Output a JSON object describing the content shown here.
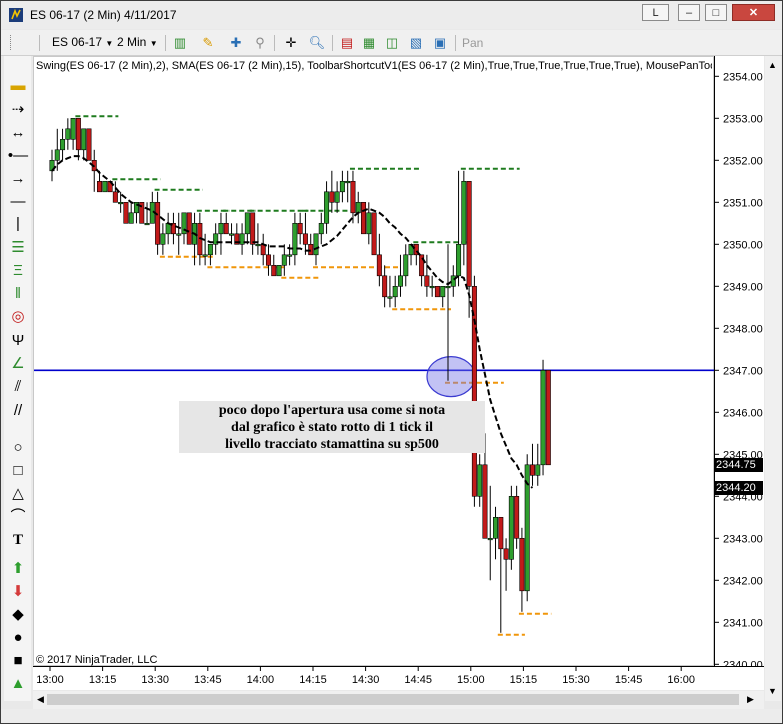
{
  "window": {
    "title": "ES 06-17 (2 Min)  4/11/2017",
    "buttons": {
      "layout": "L",
      "minimize": "–",
      "maximize": "□",
      "close": "✕"
    }
  },
  "toolbar": {
    "instrument": "ES 06-17",
    "interval": "2 Min",
    "pan_label": "Pan",
    "icons": [
      "bars-icon",
      "pencil-icon",
      "crosshair-add-icon",
      "zoom-icon",
      "crosshair-icon",
      "magnify-icon",
      "strategy-icon",
      "indicator-icon",
      "properties-icon",
      "data-box-icon"
    ]
  },
  "chart": {
    "indicator_label": "Swing(ES 06-17 (2 Min),2), SMA(ES 06-17 (2 Min),15), ToolbarShortcutV1(ES 06-17 (2 Min),True,True,True,True,True,True), MousePanTool",
    "copyright": "© 2017 NinjaTrader, LLC",
    "annotation_lines": [
      "poco dopo l'apertura usa come si nota",
      "dal grafico è stato rotto di 1 tick il",
      "livello tracciato stamattina su sp500"
    ],
    "last_price": "2344.75",
    "sma_value": "2344.20",
    "horizontal_line_price": 2347.0,
    "colors": {
      "up": "#2e9e2e",
      "down": "#c21a1a",
      "swing_high": "#1e7b1e",
      "swing_low": "#f0960a",
      "level": "#0000cc",
      "sma": "#000000"
    }
  },
  "chart_data": {
    "type": "candlestick",
    "yaxis_ticks": [
      "2354.00",
      "2353.00",
      "2352.00",
      "2351.00",
      "2350.00",
      "2349.00",
      "2348.00",
      "2347.00",
      "2346.00",
      "2345.00",
      "2344.00",
      "2343.00",
      "2342.00",
      "2341.00",
      "2340.00"
    ],
    "xaxis_ticks": [
      "13:00",
      "13:15",
      "13:30",
      "13:45",
      "14:00",
      "14:15",
      "14:30",
      "14:45",
      "15:00",
      "15:15",
      "15:30",
      "15:45",
      "16:00"
    ],
    "ylim": [
      2340,
      2354.5
    ],
    "bars": [
      {
        "t": "13:00",
        "o": 2351.75,
        "h": 2352.25,
        "l": 2351.5,
        "c": 2352.0
      },
      {
        "t": "13:02",
        "o": 2352.0,
        "h": 2352.75,
        "l": 2351.75,
        "c": 2352.25
      },
      {
        "t": "13:04",
        "o": 2352.25,
        "h": 2352.75,
        "l": 2352.0,
        "c": 2352.5
      },
      {
        "t": "13:06",
        "o": 2352.5,
        "h": 2353.0,
        "l": 2352.25,
        "c": 2352.75
      },
      {
        "t": "13:08",
        "o": 2352.5,
        "h": 2353.0,
        "l": 2352.25,
        "c": 2353.0
      },
      {
        "t": "13:10",
        "o": 2353.0,
        "h": 2353.0,
        "l": 2352.0,
        "c": 2352.25
      },
      {
        "t": "13:12",
        "o": 2352.25,
        "h": 2352.75,
        "l": 2352.0,
        "c": 2352.75
      },
      {
        "t": "13:14",
        "o": 2352.75,
        "h": 2352.75,
        "l": 2352.0,
        "c": 2352.0
      },
      {
        "t": "13:16",
        "o": 2352.0,
        "h": 2352.25,
        "l": 2351.25,
        "c": 2351.75
      },
      {
        "t": "13:18",
        "o": 2351.5,
        "h": 2351.75,
        "l": 2351.25,
        "c": 2351.25
      },
      {
        "t": "13:20",
        "o": 2351.25,
        "h": 2351.5,
        "l": 2351.25,
        "c": 2351.5
      },
      {
        "t": "13:22",
        "o": 2351.5,
        "h": 2351.5,
        "l": 2351.25,
        "c": 2351.25
      },
      {
        "t": "13:24",
        "o": 2351.25,
        "h": 2351.5,
        "l": 2351.0,
        "c": 2351.0
      },
      {
        "t": "13:26",
        "o": 2351.0,
        "h": 2351.25,
        "l": 2350.75,
        "c": 2351.0
      },
      {
        "t": "13:28",
        "o": 2351.0,
        "h": 2351.0,
        "l": 2350.5,
        "c": 2350.5
      },
      {
        "t": "13:30",
        "o": 2350.5,
        "h": 2351.0,
        "l": 2350.5,
        "c": 2350.75
      },
      {
        "t": "13:32",
        "o": 2350.75,
        "h": 2351.0,
        "l": 2350.5,
        "c": 2351.0
      },
      {
        "t": "13:34",
        "o": 2351.0,
        "h": 2351.0,
        "l": 2350.5,
        "c": 2350.5
      },
      {
        "t": "13:36",
        "o": 2350.5,
        "h": 2351.0,
        "l": 2350.5,
        "c": 2350.5
      },
      {
        "t": "13:38",
        "o": 2350.5,
        "h": 2351.25,
        "l": 2350.5,
        "c": 2351.0
      },
      {
        "t": "13:40",
        "o": 2351.0,
        "h": 2351.25,
        "l": 2349.75,
        "c": 2350.0
      },
      {
        "t": "13:42",
        "o": 2350.0,
        "h": 2350.5,
        "l": 2349.75,
        "c": 2350.25
      },
      {
        "t": "13:44",
        "o": 2350.25,
        "h": 2350.75,
        "l": 2350.0,
        "c": 2350.5
      },
      {
        "t": "13:46",
        "o": 2350.5,
        "h": 2350.75,
        "l": 2350.0,
        "c": 2350.25
      },
      {
        "t": "13:48",
        "o": 2350.25,
        "h": 2350.75,
        "l": 2349.75,
        "c": 2350.25
      },
      {
        "t": "13:50",
        "o": 2350.25,
        "h": 2350.75,
        "l": 2350.0,
        "c": 2350.75
      },
      {
        "t": "13:52",
        "o": 2350.75,
        "h": 2350.75,
        "l": 2350.0,
        "c": 2350.0
      },
      {
        "t": "13:54",
        "o": 2350.0,
        "h": 2350.75,
        "l": 2349.5,
        "c": 2350.5
      },
      {
        "t": "13:56",
        "o": 2350.5,
        "h": 2350.75,
        "l": 2349.5,
        "c": 2349.75
      },
      {
        "t": "13:58",
        "o": 2349.75,
        "h": 2350.25,
        "l": 2349.5,
        "c": 2349.75
      },
      {
        "t": "14:00",
        "o": 2349.75,
        "h": 2350.0,
        "l": 2349.5,
        "c": 2350.0
      },
      {
        "t": "14:02",
        "o": 2350.0,
        "h": 2350.5,
        "l": 2349.75,
        "c": 2350.25
      },
      {
        "t": "14:04",
        "o": 2350.25,
        "h": 2350.75,
        "l": 2349.75,
        "c": 2350.5
      },
      {
        "t": "14:06",
        "o": 2350.5,
        "h": 2350.75,
        "l": 2350.25,
        "c": 2350.25
      },
      {
        "t": "14:08",
        "o": 2350.25,
        "h": 2350.5,
        "l": 2350.0,
        "c": 2350.25
      },
      {
        "t": "14:10",
        "o": 2350.25,
        "h": 2350.5,
        "l": 2350.0,
        "c": 2350.0
      },
      {
        "t": "14:12",
        "o": 2350.0,
        "h": 2350.5,
        "l": 2349.75,
        "c": 2350.25
      },
      {
        "t": "14:14",
        "o": 2350.25,
        "h": 2350.75,
        "l": 2350.0,
        "c": 2350.75
      },
      {
        "t": "14:16",
        "o": 2350.75,
        "h": 2350.75,
        "l": 2349.75,
        "c": 2350.0
      },
      {
        "t": "14:18",
        "o": 2350.0,
        "h": 2350.5,
        "l": 2349.75,
        "c": 2350.0
      },
      {
        "t": "14:20",
        "o": 2350.0,
        "h": 2350.25,
        "l": 2349.5,
        "c": 2349.75
      },
      {
        "t": "14:22",
        "o": 2349.75,
        "h": 2350.0,
        "l": 2349.25,
        "c": 2349.5
      },
      {
        "t": "14:24",
        "o": 2349.5,
        "h": 2349.75,
        "l": 2349.25,
        "c": 2349.25
      },
      {
        "t": "14:26",
        "o": 2349.25,
        "h": 2349.5,
        "l": 2349.25,
        "c": 2349.5
      },
      {
        "t": "14:28",
        "o": 2349.5,
        "h": 2350.0,
        "l": 2349.25,
        "c": 2349.75
      },
      {
        "t": "14:30",
        "o": 2349.75,
        "h": 2350.0,
        "l": 2349.5,
        "c": 2349.75
      },
      {
        "t": "14:32",
        "o": 2349.75,
        "h": 2350.75,
        "l": 2349.5,
        "c": 2350.5
      },
      {
        "t": "14:34",
        "o": 2350.5,
        "h": 2350.75,
        "l": 2350.0,
        "c": 2350.25
      },
      {
        "t": "14:36",
        "o": 2350.25,
        "h": 2350.75,
        "l": 2349.75,
        "c": 2350.0
      },
      {
        "t": "14:38",
        "o": 2350.0,
        "h": 2350.25,
        "l": 2349.75,
        "c": 2349.75
      },
      {
        "t": "14:40",
        "o": 2349.75,
        "h": 2350.25,
        "l": 2349.5,
        "c": 2350.25
      },
      {
        "t": "14:42",
        "o": 2350.25,
        "h": 2350.75,
        "l": 2350.0,
        "c": 2350.5
      },
      {
        "t": "14:44",
        "o": 2350.5,
        "h": 2351.5,
        "l": 2350.25,
        "c": 2351.25
      },
      {
        "t": "14:46",
        "o": 2351.25,
        "h": 2351.75,
        "l": 2350.75,
        "c": 2351.0
      },
      {
        "t": "14:48",
        "o": 2351.0,
        "h": 2351.5,
        "l": 2350.75,
        "c": 2351.25
      },
      {
        "t": "14:50",
        "o": 2351.25,
        "h": 2351.75,
        "l": 2351.0,
        "c": 2351.5
      },
      {
        "t": "14:52",
        "o": 2351.5,
        "h": 2351.75,
        "l": 2351.0,
        "c": 2351.5
      },
      {
        "t": "14:54",
        "o": 2351.5,
        "h": 2351.75,
        "l": 2350.5,
        "c": 2350.75
      },
      {
        "t": "14:56",
        "o": 2350.75,
        "h": 2351.25,
        "l": 2350.5,
        "c": 2351.0
      },
      {
        "t": "14:58",
        "o": 2351.0,
        "h": 2351.0,
        "l": 2350.25,
        "c": 2350.25
      },
      {
        "t": "15:00",
        "o": 2350.25,
        "h": 2351.0,
        "l": 2350.0,
        "c": 2350.75
      },
      {
        "t": "15:02",
        "o": 2350.75,
        "h": 2350.75,
        "l": 2349.75,
        "c": 2349.75
      },
      {
        "t": "15:04",
        "o": 2349.75,
        "h": 2350.25,
        "l": 2349.0,
        "c": 2349.25
      },
      {
        "t": "15:06",
        "o": 2349.25,
        "h": 2349.5,
        "l": 2348.5,
        "c": 2348.75
      },
      {
        "t": "15:08",
        "o": 2348.75,
        "h": 2349.25,
        "l": 2348.5,
        "c": 2348.75
      },
      {
        "t": "15:10",
        "o": 2348.75,
        "h": 2349.25,
        "l": 2348.5,
        "c": 2349.0
      },
      {
        "t": "15:12",
        "o": 2349.0,
        "h": 2349.75,
        "l": 2348.75,
        "c": 2349.25
      },
      {
        "t": "15:14",
        "o": 2349.25,
        "h": 2350.0,
        "l": 2349.0,
        "c": 2349.75
      },
      {
        "t": "15:16",
        "o": 2349.75,
        "h": 2350.0,
        "l": 2349.5,
        "c": 2350.0
      },
      {
        "t": "15:18",
        "o": 2350.0,
        "h": 2350.0,
        "l": 2349.5,
        "c": 2349.75
      },
      {
        "t": "15:20",
        "o": 2349.75,
        "h": 2349.75,
        "l": 2349.0,
        "c": 2349.25
      },
      {
        "t": "15:22",
        "o": 2349.25,
        "h": 2349.75,
        "l": 2348.75,
        "c": 2349.0
      },
      {
        "t": "15:24",
        "o": 2349.0,
        "h": 2349.25,
        "l": 2348.75,
        "c": 2349.0
      },
      {
        "t": "15:26",
        "o": 2349.0,
        "h": 2349.0,
        "l": 2348.75,
        "c": 2348.75
      },
      {
        "t": "15:28",
        "o": 2348.75,
        "h": 2349.0,
        "l": 2348.5,
        "c": 2349.0
      },
      {
        "t": "15:30",
        "o": 2349.0,
        "h": 2350.0,
        "l": 2346.75,
        "c": 2349.0
      },
      {
        "t": "15:32",
        "o": 2349.0,
        "h": 2349.5,
        "l": 2348.75,
        "c": 2349.25
      },
      {
        "t": "15:34",
        "o": 2349.25,
        "h": 2351.75,
        "l": 2349.0,
        "c": 2350.0
      },
      {
        "t": "15:36",
        "o": 2350.0,
        "h": 2351.75,
        "l": 2349.5,
        "c": 2351.5
      },
      {
        "t": "15:38",
        "o": 2351.5,
        "h": 2351.5,
        "l": 2348.25,
        "c": 2349.0
      },
      {
        "t": "15:40",
        "o": 2349.0,
        "h": 2349.25,
        "l": 2343.75,
        "c": 2344.0
      },
      {
        "t": "15:42",
        "o": 2344.0,
        "h": 2345.0,
        "l": 2343.75,
        "c": 2344.75
      },
      {
        "t": "15:44",
        "o": 2344.75,
        "h": 2345.5,
        "l": 2343.0,
        "c": 2343.0
      },
      {
        "t": "15:46",
        "o": 2343.0,
        "h": 2344.25,
        "l": 2342.0,
        "c": 2343.0
      },
      {
        "t": "15:48",
        "o": 2343.0,
        "h": 2343.75,
        "l": 2342.5,
        "c": 2343.5
      },
      {
        "t": "15:50",
        "o": 2343.5,
        "h": 2343.5,
        "l": 2340.75,
        "c": 2342.75
      },
      {
        "t": "15:52",
        "o": 2342.75,
        "h": 2343.0,
        "l": 2341.75,
        "c": 2342.5
      },
      {
        "t": "15:54",
        "o": 2342.5,
        "h": 2344.25,
        "l": 2342.25,
        "c": 2344.0
      },
      {
        "t": "15:56",
        "o": 2344.0,
        "h": 2344.25,
        "l": 2342.75,
        "c": 2343.0
      },
      {
        "t": "15:58",
        "o": 2343.0,
        "h": 2343.25,
        "l": 2341.25,
        "c": 2341.75
      },
      {
        "t": "16:00",
        "o": 2341.75,
        "h": 2345.0,
        "l": 2341.5,
        "c": 2344.75
      },
      {
        "t": "16:02",
        "o": 2344.75,
        "h": 2345.25,
        "l": 2344.25,
        "c": 2344.5
      },
      {
        "t": "16:04",
        "o": 2344.5,
        "h": 2345.25,
        "l": 2344.25,
        "c": 2344.75
      },
      {
        "t": "16:06",
        "o": 2344.75,
        "h": 2347.25,
        "l": 2344.5,
        "c": 2347.0
      },
      {
        "t": "16:08",
        "o": 2347.0,
        "h": 2347.0,
        "l": 2344.75,
        "c": 2344.75
      }
    ],
    "sma": [
      2351.75,
      2351.9,
      2352.0,
      2352.05,
      2352.1,
      2352.1,
      2352.05,
      2351.95,
      2351.85,
      2351.7,
      2351.6,
      2351.5,
      2351.35,
      2351.2,
      2351.1,
      2351.0,
      2350.95,
      2350.9,
      2350.85,
      2350.8,
      2350.7,
      2350.6,
      2350.5,
      2350.45,
      2350.4,
      2350.35,
      2350.3,
      2350.25,
      2350.15,
      2350.1,
      2350.05,
      2350.05,
      2350.05,
      2350.05,
      2350.05,
      2350.05,
      2350.05,
      2350.05,
      2350.05,
      2350.05,
      2350.0,
      2349.95,
      2349.95,
      2349.95,
      2349.95,
      2349.9,
      2349.9,
      2349.9,
      2349.85,
      2349.85,
      2349.9,
      2349.95,
      2350.0,
      2350.1,
      2350.2,
      2350.35,
      2350.5,
      2350.65,
      2350.75,
      2350.8,
      2350.85,
      2350.8,
      2350.75,
      2350.65,
      2350.5,
      2350.4,
      2350.25,
      2350.15,
      2350.0,
      2349.85,
      2349.7,
      2349.5,
      2349.35,
      2349.2,
      2349.1,
      2349.05,
      2349.15,
      2349.25,
      2349.2,
      2348.8,
      2348.2,
      2347.5,
      2346.9,
      2346.3,
      2345.9,
      2345.5,
      2345.2,
      2344.9,
      2344.75,
      2344.5,
      2344.3,
      2344.2
    ]
  }
}
